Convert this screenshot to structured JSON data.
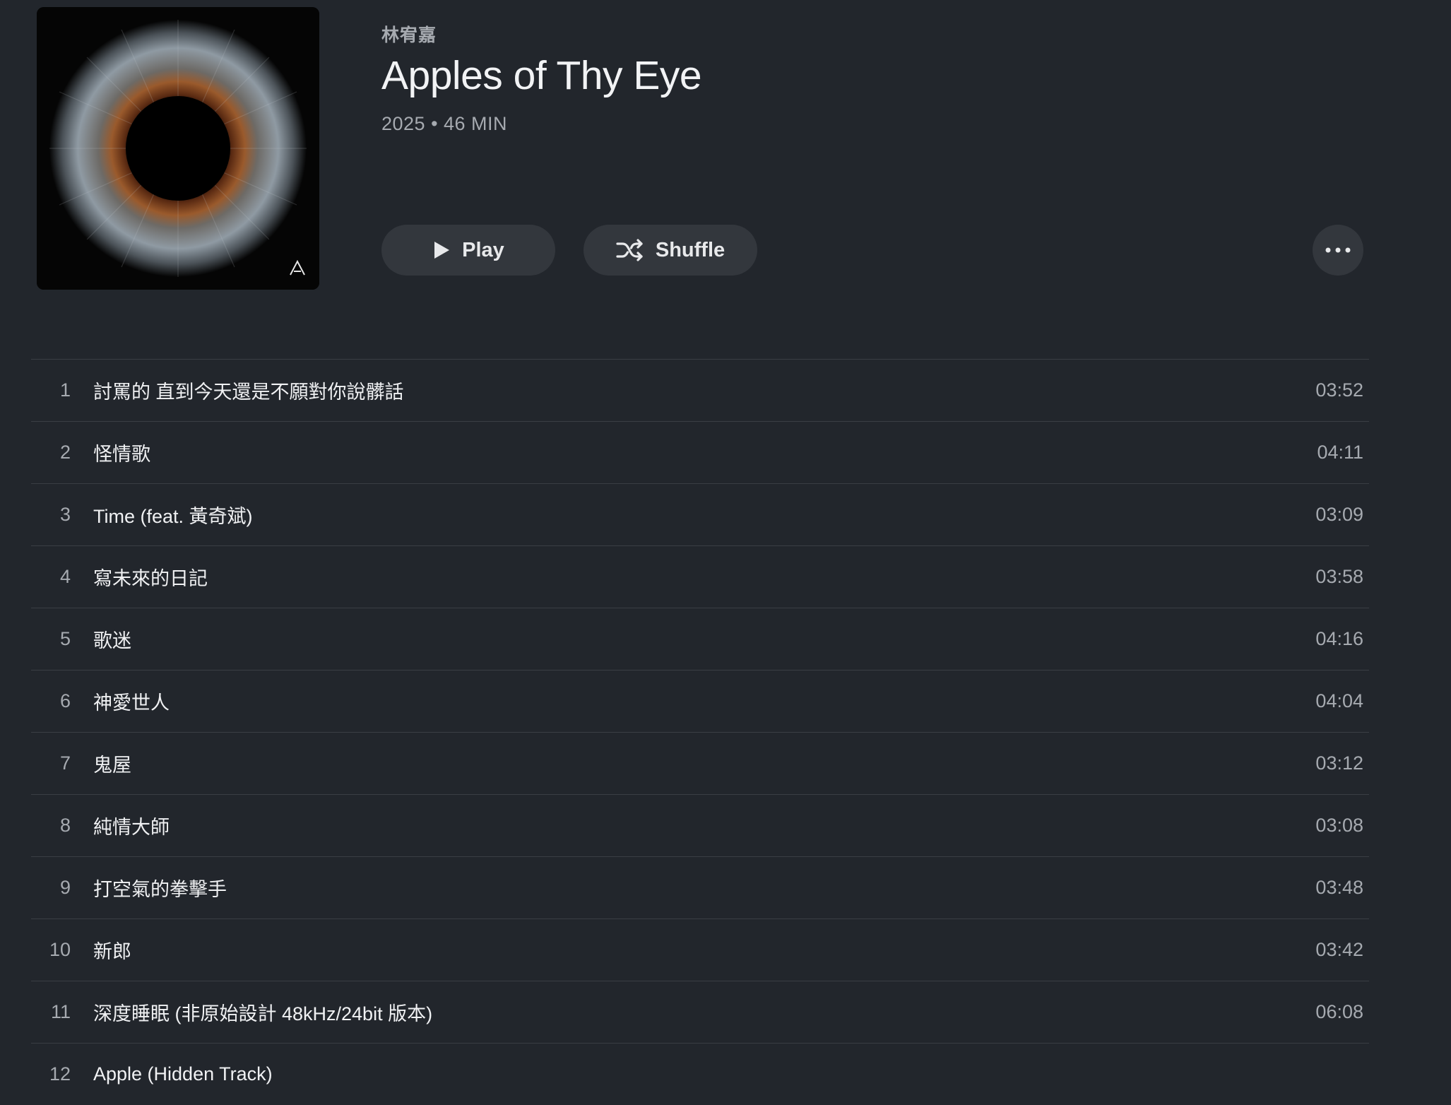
{
  "album": {
    "artist": "林宥嘉",
    "title": "Apples of Thy Eye",
    "meta": "2025 • 46 MIN"
  },
  "actions": {
    "play_label": "Play",
    "shuffle_label": "Shuffle"
  },
  "tracks": [
    {
      "num": "1",
      "name": "討罵的 直到今天還是不願對你說髒話",
      "duration": "03:52"
    },
    {
      "num": "2",
      "name": "怪情歌",
      "duration": "04:11"
    },
    {
      "num": "3",
      "name": "Time (feat. 黃奇斌)",
      "duration": "03:09"
    },
    {
      "num": "4",
      "name": "寫未來的日記",
      "duration": "03:58"
    },
    {
      "num": "5",
      "name": "歌迷",
      "duration": "04:16"
    },
    {
      "num": "6",
      "name": "神愛世人",
      "duration": "04:04"
    },
    {
      "num": "7",
      "name": "鬼屋",
      "duration": "03:12"
    },
    {
      "num": "8",
      "name": "純情大師",
      "duration": "03:08"
    },
    {
      "num": "9",
      "name": "打空氣的拳擊手",
      "duration": "03:48"
    },
    {
      "num": "10",
      "name": "新郎",
      "duration": "03:42"
    },
    {
      "num": "11",
      "name": "深度睡眠 (非原始設計 48kHz/24bit 版本)",
      "duration": "06:08"
    },
    {
      "num": "12",
      "name": "Apple (Hidden Track)",
      "duration": ""
    }
  ],
  "icons": {
    "cover_badge": "lambda-logo-icon",
    "play": "play-icon",
    "shuffle": "shuffle-icon",
    "more": "ellipsis-icon"
  },
  "colors": {
    "background": "#22262c",
    "button_bg": "#33373d",
    "text_primary": "#f0f1f3",
    "text_secondary": "#a6aab0",
    "divider": "#3a3e44"
  }
}
